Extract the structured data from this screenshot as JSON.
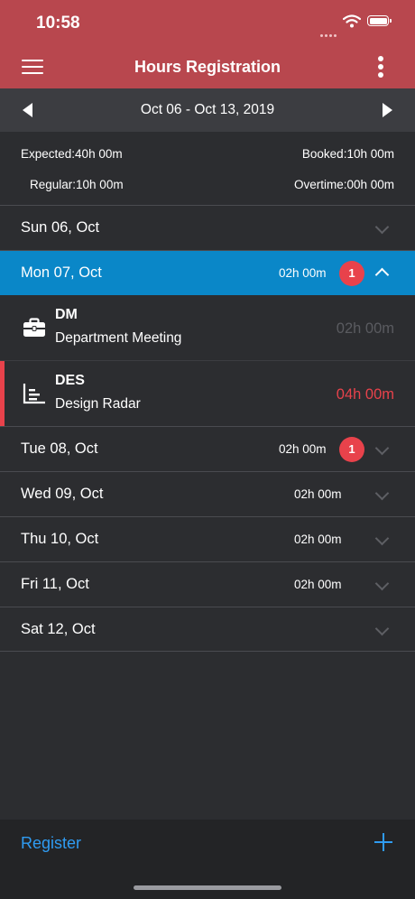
{
  "status": {
    "time": "10:58"
  },
  "header": {
    "title": "Hours Registration"
  },
  "week": {
    "range": "Oct 06 - Oct 13, 2019"
  },
  "summary": {
    "expected_label": "Expected:",
    "expected_value": "40h 00m",
    "booked_label": "Booked:",
    "booked_value": "10h 00m",
    "regular_label": "Regular:",
    "regular_value": "10h 00m",
    "overtime_label": "Overtime:",
    "overtime_value": "00h 00m"
  },
  "days": [
    {
      "label": "Sun 06, Oct",
      "hours": "",
      "badge": ""
    },
    {
      "label": "Mon 07, Oct",
      "hours": "02h 00m",
      "badge": "1"
    },
    {
      "label": "Tue 08, Oct",
      "hours": "02h 00m",
      "badge": "1"
    },
    {
      "label": "Wed 09, Oct",
      "hours": "02h 00m",
      "badge": ""
    },
    {
      "label": "Thu 10, Oct",
      "hours": "02h 00m",
      "badge": ""
    },
    {
      "label": "Fri 11, Oct",
      "hours": "02h 00m",
      "badge": ""
    },
    {
      "label": "Sat 12, Oct",
      "hours": "",
      "badge": ""
    }
  ],
  "entries": [
    {
      "code": "DM",
      "name": "Department Meeting",
      "hours": "02h 00m",
      "icon": "briefcase-icon"
    },
    {
      "code": "DES",
      "name": "Design Radar",
      "hours": "04h 00m",
      "icon": "chart-icon"
    }
  ],
  "footer": {
    "register_label": "Register"
  },
  "colors": {
    "brand": "#b8474e",
    "selected_day": "#0a87c8",
    "badge": "#e8424b",
    "accent_link": "#2f9cf2",
    "background": "#2c2d30"
  }
}
